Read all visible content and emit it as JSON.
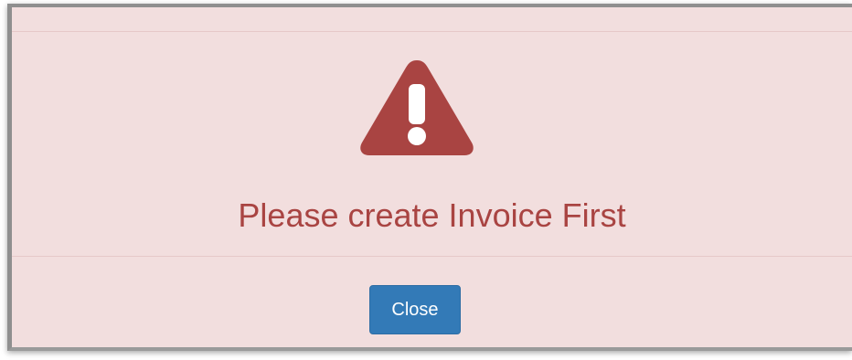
{
  "dialog": {
    "message": "Please create Invoice First",
    "icon": "warning-icon",
    "close_label": "Close"
  },
  "colors": {
    "dialog_background": "#f2dede",
    "message_text": "#a94442",
    "icon_fill": "#a94442",
    "button_background": "#337ab7",
    "button_text": "#ffffff"
  }
}
